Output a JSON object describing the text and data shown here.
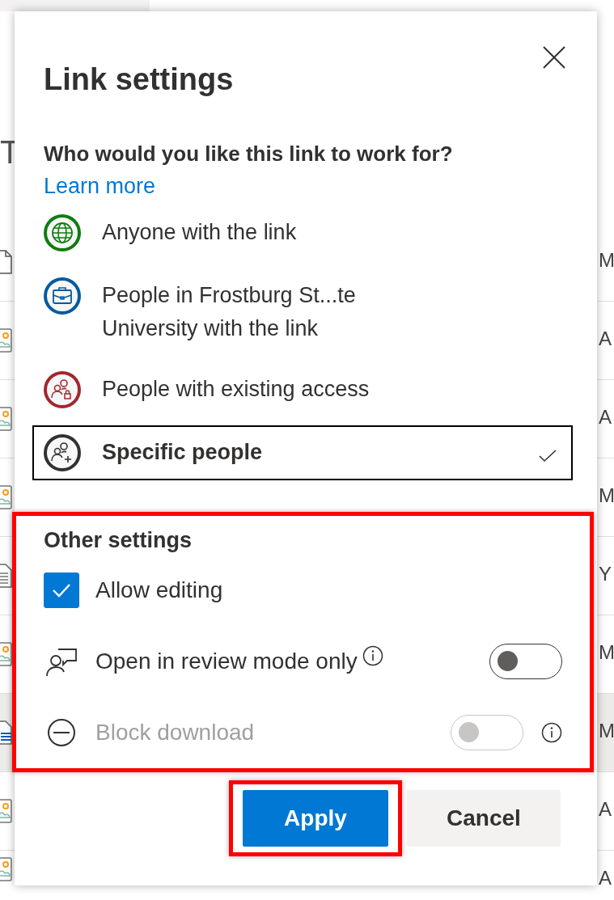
{
  "file_list": {
    "header_fragment": "T",
    "rows": [
      {
        "column_fragment": "M",
        "selected": false
      },
      {
        "column_fragment": "A",
        "selected": false
      },
      {
        "column_fragment": "A",
        "selected": false
      },
      {
        "column_fragment": "M",
        "selected": false
      },
      {
        "column_fragment": "Y",
        "selected": false
      },
      {
        "column_fragment": "M",
        "selected": false
      },
      {
        "column_fragment": "M",
        "selected": true
      },
      {
        "column_fragment": "A",
        "selected": false
      },
      {
        "column_fragment": "A",
        "selected": false
      }
    ]
  },
  "dialog": {
    "title": "Link settings",
    "question": "Who would you like this link to work for?",
    "learn_more": "Learn more",
    "audiences": [
      {
        "lines": [
          "Anyone with the link"
        ],
        "color": "#107c10",
        "selected": false
      },
      {
        "lines": [
          "People in Frostburg St...te",
          "University with the link"
        ],
        "color": "#005a9e",
        "selected": false
      },
      {
        "lines": [
          "People with existing access"
        ],
        "color": "#a4262c",
        "selected": false
      },
      {
        "lines": [
          "Specific people"
        ],
        "color": "#323130",
        "selected": true
      }
    ],
    "other_settings": {
      "heading": "Other settings",
      "highlighted": true,
      "items": [
        {
          "kind": "checkbox",
          "label": "Allow editing",
          "checked": true
        },
        {
          "kind": "toggle",
          "label": "Open in review mode only",
          "on": false,
          "disabled": false
        },
        {
          "kind": "toggle",
          "label": "Block download",
          "on": false,
          "disabled": true
        }
      ]
    },
    "buttons": [
      {
        "label": "Apply",
        "primary": true,
        "highlighted": true
      },
      {
        "label": "Cancel",
        "primary": false,
        "highlighted": false
      }
    ]
  }
}
